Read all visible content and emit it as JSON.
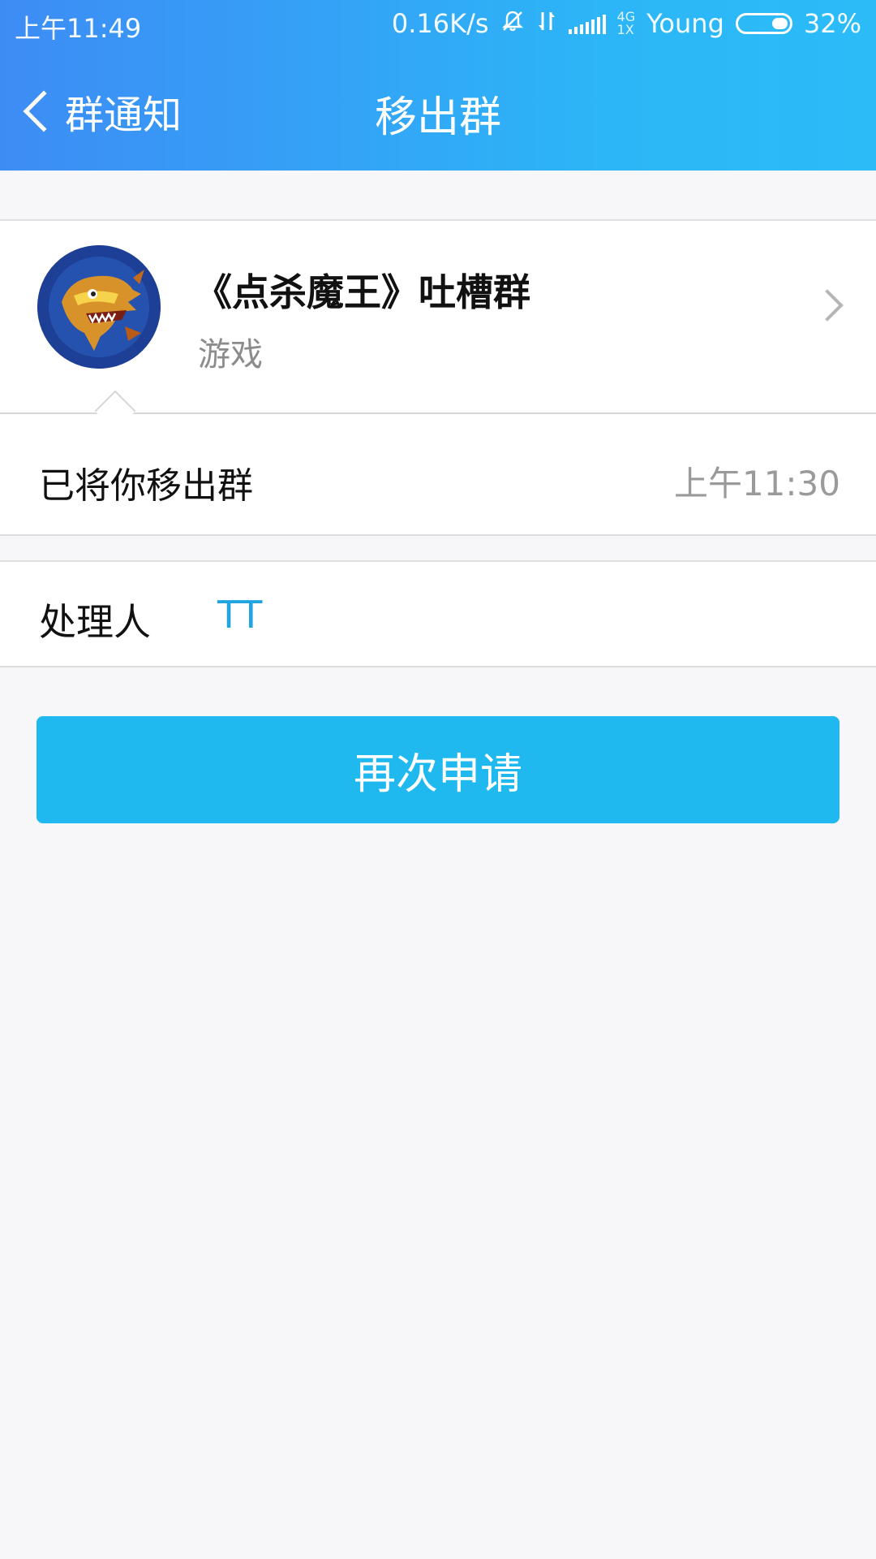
{
  "status_bar": {
    "time": "上午11:49",
    "network_speed": "0.16K/s",
    "carrier": "Young",
    "battery_percent": "32%",
    "battery_level": 0.32,
    "net_type_top": "4G",
    "net_type_bottom": "1X",
    "icons": [
      "bell-mute-icon",
      "data-transfer-icon",
      "signal-icon",
      "battery-icon"
    ]
  },
  "nav": {
    "back_label": "群通知",
    "title": "移出群"
  },
  "group": {
    "name": "《点杀魔王》吐槽群",
    "category": "游戏",
    "avatar_icon": "dragon-avatar-icon"
  },
  "notice": {
    "text": "已将你移出群",
    "time": "上午11:30"
  },
  "handler": {
    "label": "处理人",
    "name": "TT"
  },
  "actions": {
    "reapply_label": "再次申请"
  },
  "colors": {
    "header_start": "#3d8cf5",
    "header_end": "#2bbcf8",
    "button": "#1fb8ef",
    "link": "#1fa6e0"
  }
}
